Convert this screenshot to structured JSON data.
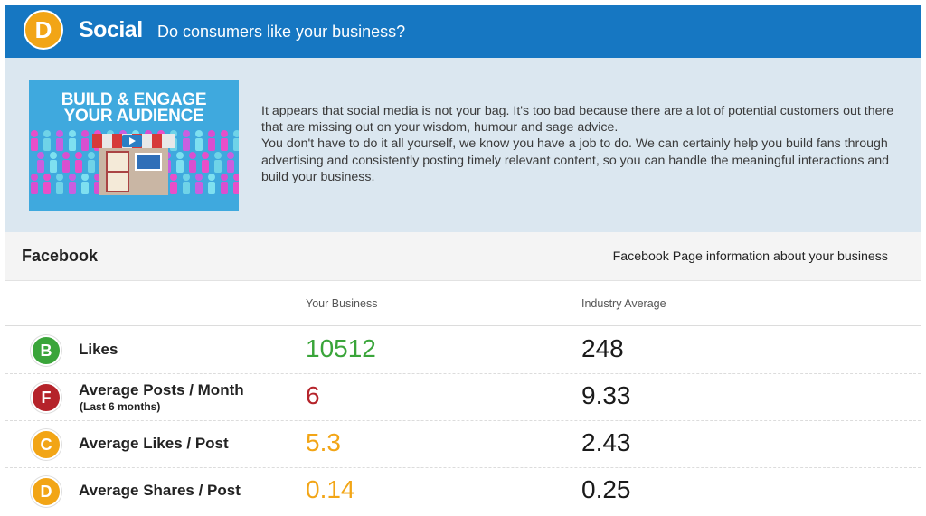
{
  "header": {
    "grade": "D",
    "grade_color": "#f2a516",
    "title": "Social",
    "subtitle": "Do consumers like your business?"
  },
  "intro": {
    "promo_line1": "BUILD & ENGAGE",
    "promo_line2": "YOUR AUDIENCE",
    "paragraph1": "It appears that social media is not your bag. It's too bad because there are a lot of potential customers out there that are missing out on your wisdom, humour and sage advice.",
    "paragraph2": "You don't have to do it all yourself, we know you have a job to do. We can certainly help you build fans through advertising and consistently posting timely relevant content, so you can handle the meaningful interactions and build your business."
  },
  "facebook": {
    "title": "Facebook",
    "info": "Facebook Page information about your business",
    "col_yours": "Your Business",
    "col_avg": "Industry Average",
    "rows": [
      {
        "grade": "B",
        "grade_color": "#3aa53a",
        "label": "Likes",
        "sub": "",
        "yours": "10512",
        "yours_color": "#3aa53a",
        "avg": "248"
      },
      {
        "grade": "F",
        "grade_color": "#b5232a",
        "label": "Average Posts / Month",
        "sub": "(Last 6 months)",
        "yours": "6",
        "yours_color": "#b5232a",
        "avg": "9.33"
      },
      {
        "grade": "C",
        "grade_color": "#f2a516",
        "label": "Average Likes / Post",
        "sub": "",
        "yours": "5.3",
        "yours_color": "#f2a516",
        "avg": "2.43"
      },
      {
        "grade": "D",
        "grade_color": "#f2a516",
        "label": "Average Shares / Post",
        "sub": "",
        "yours": "0.14",
        "yours_color": "#f2a516",
        "avg": "0.25"
      }
    ]
  }
}
